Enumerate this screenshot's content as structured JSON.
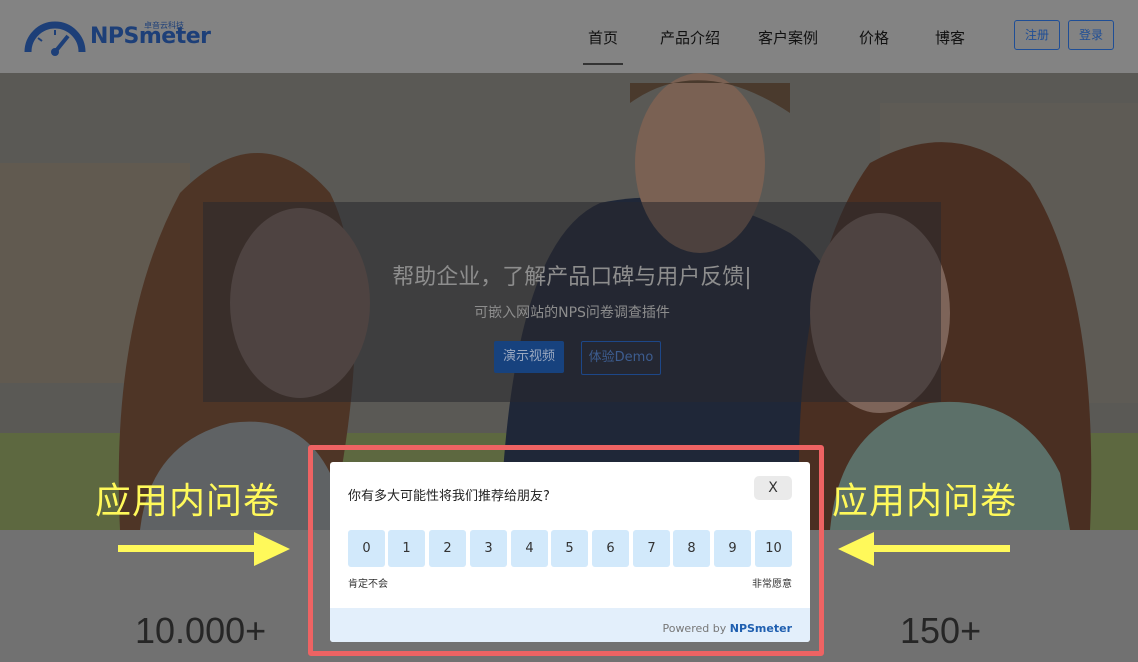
{
  "header": {
    "brand": "NPSmeter",
    "brand_sub": "卓音云科技",
    "nav": [
      "首页",
      "产品介绍",
      "客户案例",
      "价格",
      "博客"
    ],
    "register": "注册",
    "login": "登录"
  },
  "hero": {
    "title": "帮助企业，了解产品口碑与用户反馈|",
    "subtitle": "可嵌入网站的NPS问卷调查插件",
    "btn_video": "演示视频",
    "btn_demo": "体验Demo"
  },
  "stats": [
    "10.000+",
    "150+"
  ],
  "annotation": {
    "label": "应用内问卷"
  },
  "survey": {
    "question": "你有多大可能性将我们推荐给朋友?",
    "close": "X",
    "scores": [
      "0",
      "1",
      "2",
      "3",
      "4",
      "5",
      "6",
      "7",
      "8",
      "9",
      "10"
    ],
    "low_label": "肯定不会",
    "high_label": "非常愿意",
    "powered_by": "Powered by",
    "powered_brand": "NPSmeter"
  },
  "colors": {
    "frame": "#ee6363",
    "annotation": "#fff95a",
    "score_bg": "#d2e9fb",
    "brand": "#1d3f78"
  }
}
